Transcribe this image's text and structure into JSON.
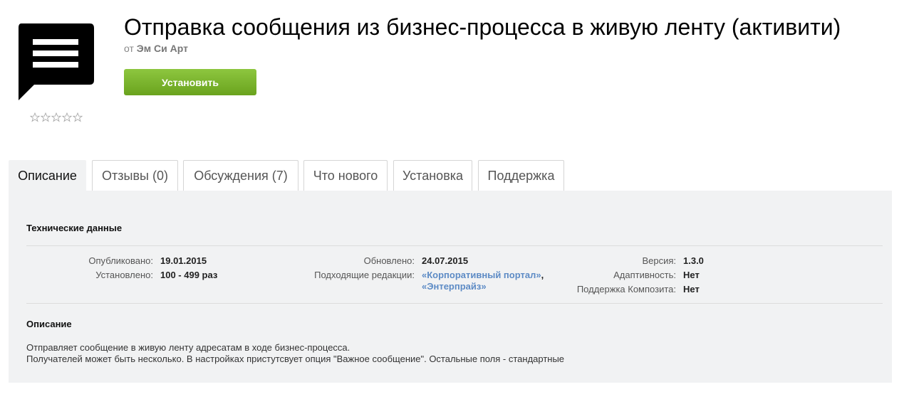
{
  "header": {
    "app_icon": "speech-bubble-list-icon",
    "rating_icons": [
      "star-outline-icon",
      "star-outline-icon",
      "star-outline-icon",
      "star-outline-icon",
      "star-outline-icon"
    ],
    "title": "Отправка сообщения из бизнес-процесса в живую ленту (активити)",
    "author_prefix": "от",
    "author_name": "Эм Си Арт",
    "install_label": "Установить"
  },
  "tabs": [
    {
      "label": "Описание",
      "active": true
    },
    {
      "label": "Отзывы (0)",
      "active": false
    },
    {
      "label": "Обсуждения (7)",
      "active": false
    },
    {
      "label": "Что нового",
      "active": false
    },
    {
      "label": "Установка",
      "active": false
    },
    {
      "label": "Поддержка",
      "active": false
    }
  ],
  "tech": {
    "heading": "Технические данные",
    "published_label": "Опубликовано:",
    "published_value": "19.01.2015",
    "installed_label": "Установлено:",
    "installed_value": "100 - 499 раз",
    "updated_label": "Обновлено:",
    "updated_value": "24.07.2015",
    "editions_label": "Подходящие редакции:",
    "edition_1": "«Корпоративный портал»",
    "edition_sep": ",",
    "edition_2": "«Энтерпрайз»",
    "version_label": "Версия:",
    "version_value": "1.3.0",
    "adaptive_label": "Адаптивность:",
    "adaptive_value": "Нет",
    "composite_label": "Поддержка Композита:",
    "composite_value": "Нет"
  },
  "description": {
    "heading": "Описание",
    "line1": "Отправляет сообщение в живую ленту адресатам в ходе бизнес-процесса.",
    "line2": "Получателей может быть несколько. В настройках пристутсвует опция \"Важное сообщение\". Остальные поля - стандартные"
  },
  "colors": {
    "install_button": "#7cb82f",
    "link": "#5d8bc5",
    "panel_background": "#f1f2f3"
  }
}
